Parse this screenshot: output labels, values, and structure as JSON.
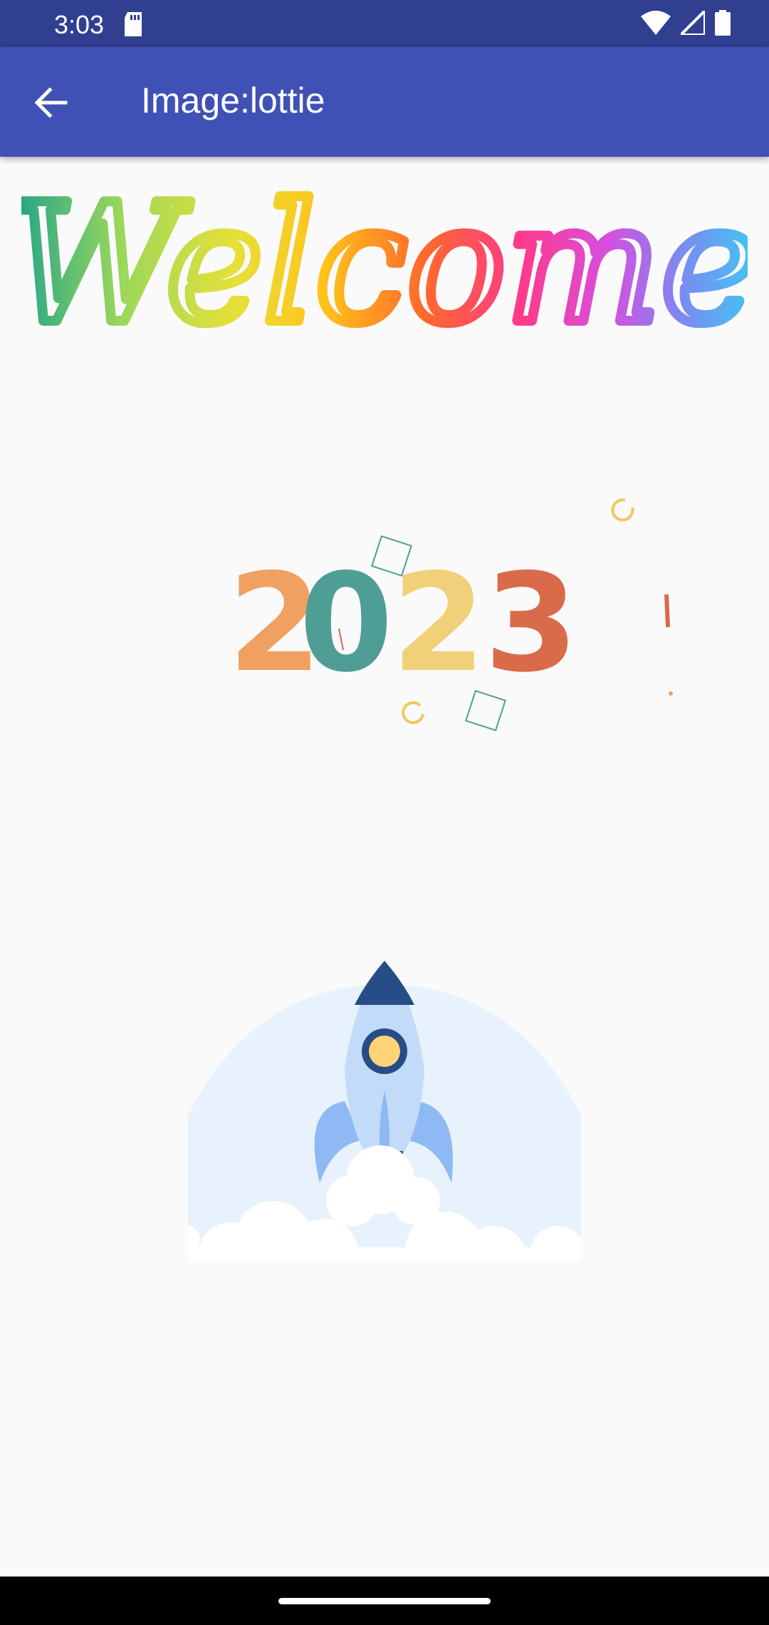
{
  "status_bar": {
    "time": "3:03",
    "icons": [
      "sd-card-icon",
      "wifi-icon",
      "cell-signal-icon",
      "battery-icon"
    ]
  },
  "app_bar": {
    "title": "Image:lottie",
    "back_icon": "arrow-left-icon"
  },
  "animations": {
    "welcome": {
      "text": "Welcome"
    },
    "year": {
      "digits": [
        "2",
        "0",
        "2",
        "3"
      ]
    },
    "rocket": {
      "icon": "rocket-icon"
    }
  },
  "colors": {
    "status_bar": "#303f8f",
    "app_bar": "#3f51b5",
    "background": "#fafafa",
    "digit_2a": "#f0a060",
    "digit_0": "#4e9e96",
    "digit_2b": "#f0d078",
    "digit_3": "#d96b4a"
  }
}
